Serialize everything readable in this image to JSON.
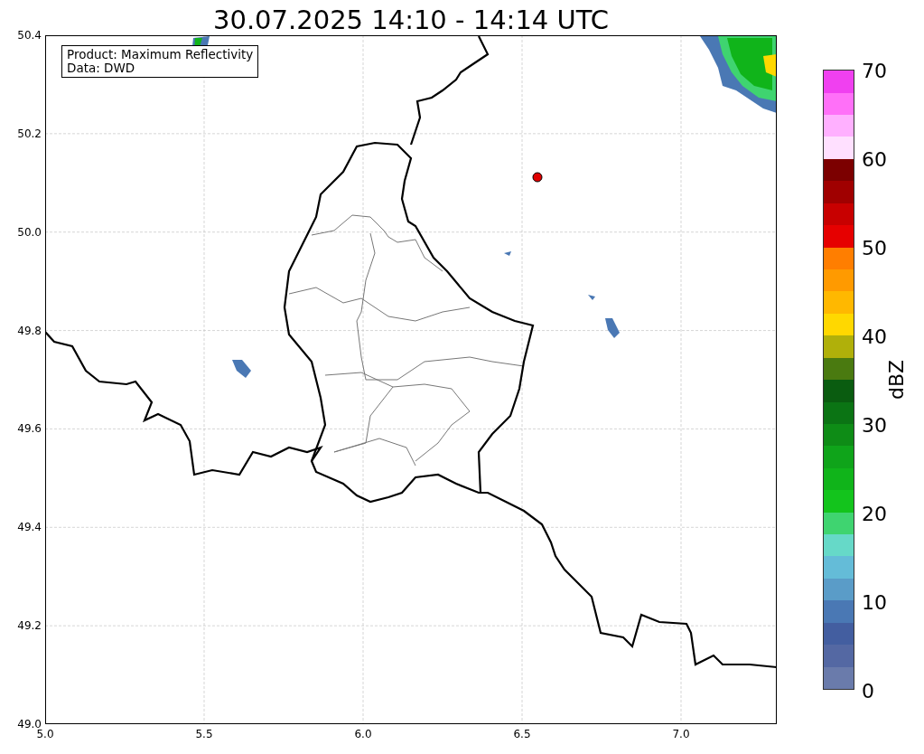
{
  "title": "30.07.2025 14:10 - 14:14 UTC",
  "legend": {
    "lines": [
      "Product: Maximum Reflectivity",
      "Data: DWD"
    ]
  },
  "axes": {
    "xticks": [
      "5.0",
      "5.5",
      "6.0",
      "6.5",
      "7.0"
    ],
    "yticks": [
      "50.4",
      "50.2",
      "50.0",
      "49.8",
      "49.6",
      "49.4",
      "49.2",
      "49.0"
    ]
  },
  "colorbar": {
    "label": "dBZ",
    "ticks": [
      "70",
      "60",
      "50",
      "40",
      "30",
      "20",
      "10",
      "0"
    ],
    "segments": [
      {
        "color": "#6a7bab"
      },
      {
        "color": "#5468a3"
      },
      {
        "color": "#435ea0"
      },
      {
        "color": "#4a78b4"
      },
      {
        "color": "#5a9cc8"
      },
      {
        "color": "#64bcd8"
      },
      {
        "color": "#66d9c8"
      },
      {
        "color": "#3fd470"
      },
      {
        "color": "#13c41c"
      },
      {
        "color": "#10b41a"
      },
      {
        "color": "#0fa41a"
      },
      {
        "color": "#0e8c16"
      },
      {
        "color": "#0b7414"
      },
      {
        "color": "#0a5c10"
      },
      {
        "color": "#4a7a10"
      },
      {
        "color": "#b0b00a"
      },
      {
        "color": "#ffd800"
      },
      {
        "color": "#ffb800"
      },
      {
        "color": "#ff9a00"
      },
      {
        "color": "#ff7e00"
      },
      {
        "color": "#e60000"
      },
      {
        "color": "#c80000"
      },
      {
        "color": "#a00000"
      },
      {
        "color": "#7c0000"
      },
      {
        "color": "#ffe0ff"
      },
      {
        "color": "#ffb0ff"
      },
      {
        "color": "#ff70f8"
      },
      {
        "color": "#f040f0"
      }
    ]
  }
}
